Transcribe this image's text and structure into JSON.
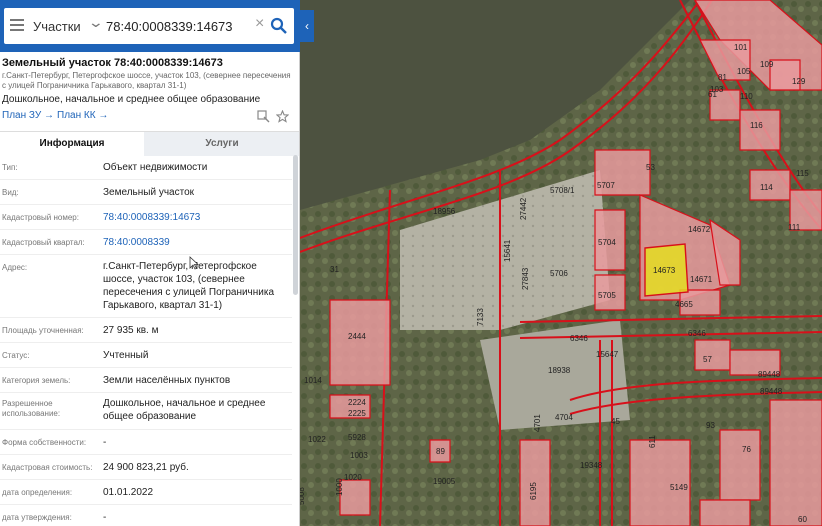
{
  "search": {
    "type": "Участки",
    "value": "78:40:0008339:14673",
    "clear": "×",
    "collapse": "‹"
  },
  "parcel": {
    "title": "Земельный участок 78:40:0008339:14673",
    "address_short": "г.Санкт-Петербург, Петергофское шоссе, участок 103, (севернее пересечения с улицей Пограничника Гарькавого, квартал 31-1)",
    "purpose": "Дошкольное, начальное и среднее общее образование",
    "link_zu": "План ЗУ →",
    "link_kk": "План КК →"
  },
  "tabs": {
    "info": "Информация",
    "services": "Услуги"
  },
  "rows": [
    {
      "label": "Тип:",
      "value": "Объект недвижимости"
    },
    {
      "label": "Вид:",
      "value": "Земельный участок"
    },
    {
      "label": "Кадастровый номер:",
      "value": "78:40:0008339:14673",
      "link": true
    },
    {
      "label": "Кадастровый квартал:",
      "value": "78:40:0008339",
      "link": true
    },
    {
      "label": "Адрес:",
      "value": "г.Санкт-Петербург, Петергофское шоссе, участок 103, (севернее пересечения с улицей Пограничника Гарькавого, квартал 31-1)"
    },
    {
      "label": "Площадь уточненная:",
      "value": "27 935 кв. м"
    },
    {
      "label": "Статус:",
      "value": "Учтенный"
    },
    {
      "label": "Категория земель:",
      "value": "Земли населённых пунктов"
    },
    {
      "label": "Разрешенное использование:",
      "value": "Дошкольное, начальное и среднее общее образование"
    },
    {
      "label": "Форма собственности:",
      "value": "-"
    },
    {
      "label": "Кадастровая стоимость:",
      "value": "24 900 823,21 руб."
    },
    {
      "label": "дата определения:",
      "value": "01.01.2022"
    },
    {
      "label": "дата утверждения:",
      "value": "-"
    }
  ],
  "colors": {
    "accent": "#1e63b8",
    "parcel_fill": "#e89a9e",
    "parcel_border": "#d8101a",
    "selected_fill": "#e6e21a"
  },
  "map": {
    "labels": [
      "101",
      "109",
      "129",
      "81",
      "105",
      "61",
      "103",
      "110",
      "116",
      "111",
      "114",
      "115",
      "53",
      "5707",
      "5708/1",
      "27442",
      "18956",
      "5704",
      "14672",
      "14673",
      "14671",
      "15641",
      "27843",
      "5706",
      "5705",
      "4665",
      "6346",
      "6346",
      "15647",
      "31",
      "7133",
      "2444",
      "57",
      "1014",
      "18938",
      "89448",
      "89448",
      "2224",
      "2225",
      "4704",
      "4701",
      "45",
      "93",
      "1022",
      "5928",
      "89",
      "1003",
      "1000",
      "1020",
      "19005",
      "6195",
      "5149",
      "76",
      "60",
      "611",
      "19348",
      "5008"
    ]
  }
}
